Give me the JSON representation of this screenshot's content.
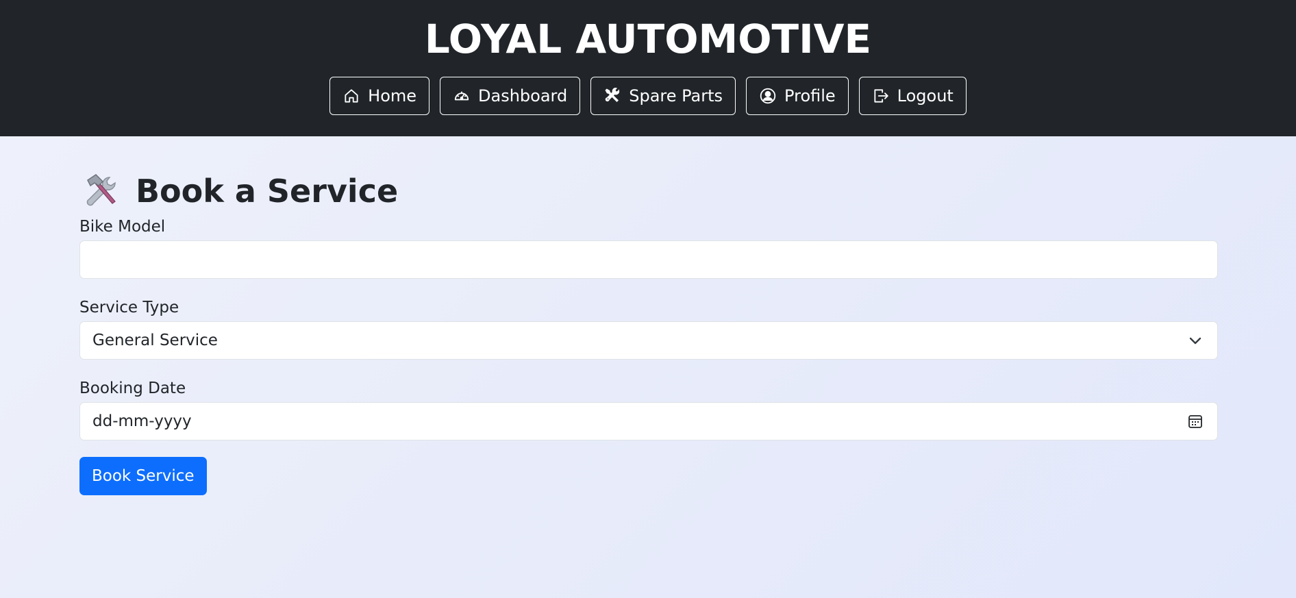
{
  "header": {
    "brand": "LOYAL AUTOMOTIVE",
    "nav": [
      {
        "label": "Home",
        "icon": "home-icon"
      },
      {
        "label": "Dashboard",
        "icon": "speedometer-icon"
      },
      {
        "label": "Spare Parts",
        "icon": "tools-icon"
      },
      {
        "label": "Profile",
        "icon": "person-circle-icon"
      },
      {
        "label": "Logout",
        "icon": "logout-icon"
      }
    ]
  },
  "main": {
    "title_icon": "hammer-wrench-icon",
    "title": "Book a Service",
    "bike_model": {
      "label": "Bike Model",
      "value": ""
    },
    "service_type": {
      "label": "Service Type",
      "value": "General Service"
    },
    "booking_date": {
      "label": "Booking Date",
      "placeholder": "dd-mm-yyyy"
    },
    "submit_label": "Book Service"
  },
  "colors": {
    "navbar_bg": "#212529",
    "primary": "#0d6efd",
    "background": "#e8ecfa"
  }
}
